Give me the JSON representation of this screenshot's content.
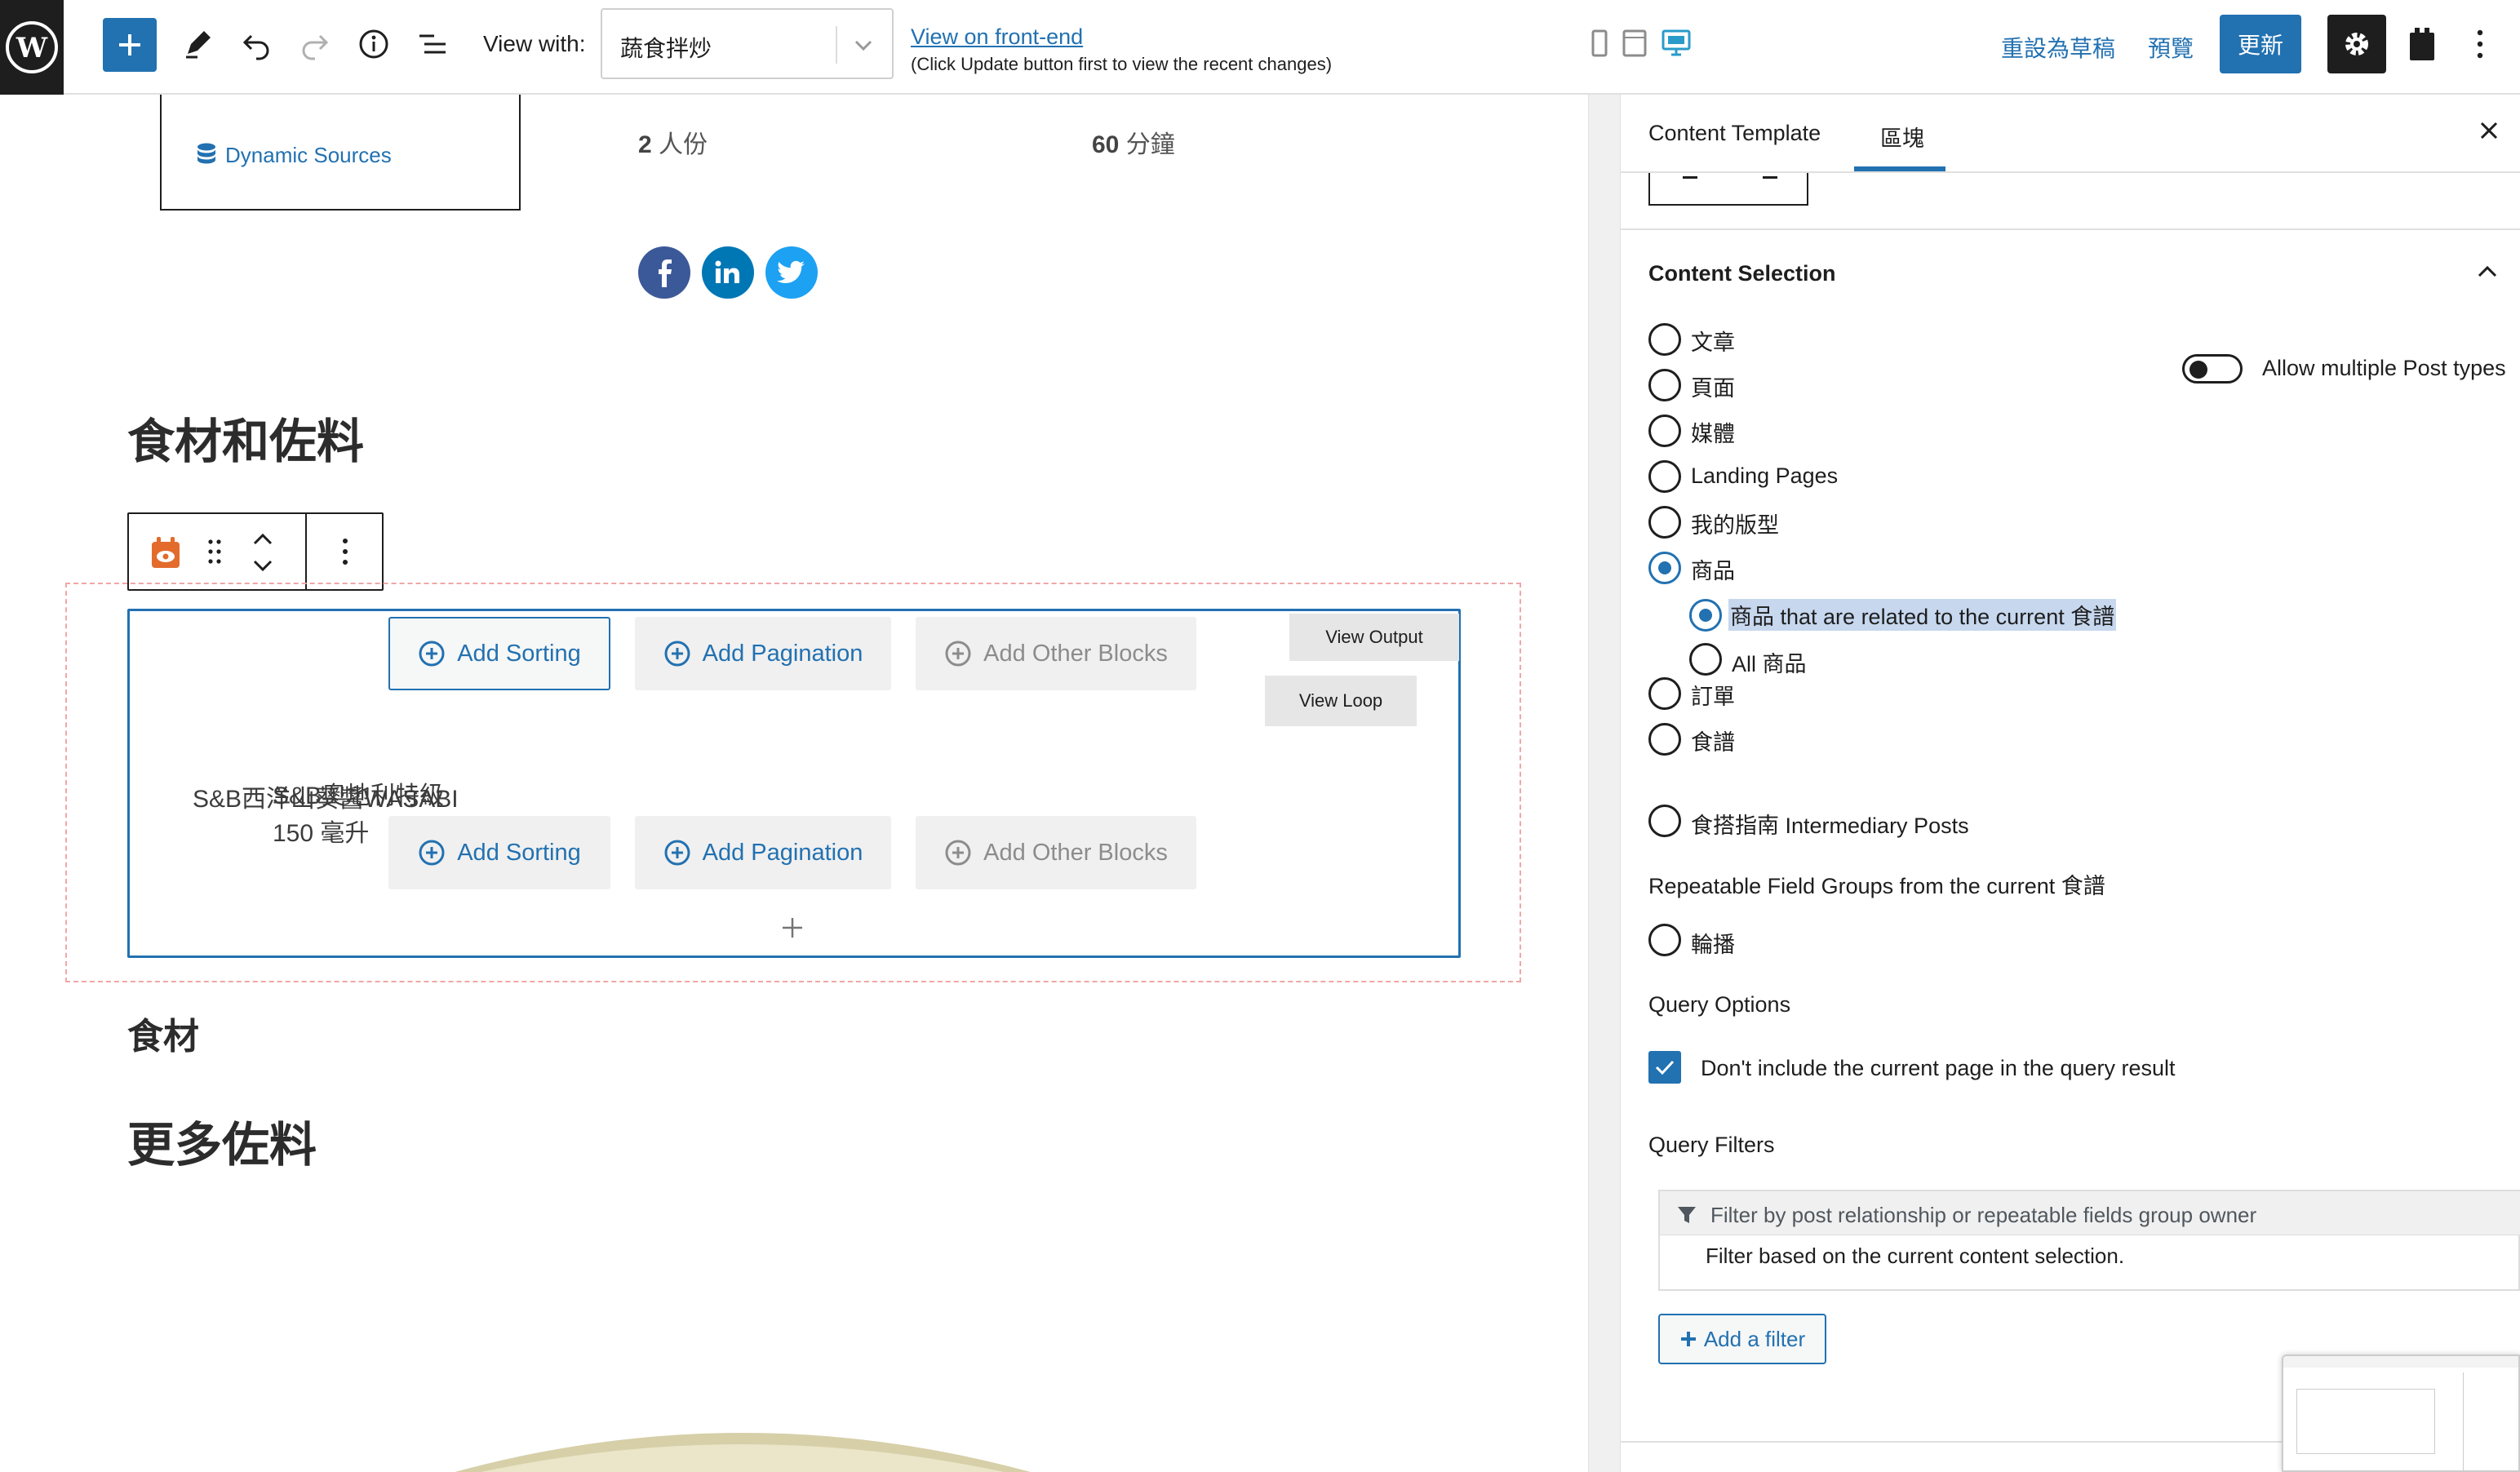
{
  "toolbar": {
    "view_with_label": "View with:",
    "view_with_value": "蔬食拌炒",
    "frontend_link": "View on front-end",
    "frontend_note": "(Click Update button first to view the recent changes)",
    "reset_draft": "重設為草稿",
    "preview": "預覽",
    "update": "更新"
  },
  "canvas": {
    "dynamic_sources": "Dynamic Sources",
    "servings_num": "2",
    "servings_unit": "人份",
    "time_num": "60",
    "time_unit": "分鐘",
    "heading_ingredients_seasoning": "食材和佐料",
    "heading_ingredients": "食材",
    "heading_more_seasoning": "更多佐料",
    "loop": {
      "add_sorting": "Add Sorting",
      "add_pagination": "Add Pagination",
      "add_other_blocks": "Add Other Blocks",
      "view_output": "View Output",
      "view_loop": "View Loop",
      "overlap_text_a": "S&B西洋山葵醬WASABI",
      "overlap_text_b": "S&B奧地利特級",
      "overlap_text_c": "150 毫升"
    }
  },
  "sidebar": {
    "tab_content_template": "Content Template",
    "tab_block": "區塊",
    "content_selection_title": "Content Selection",
    "post_types": [
      "文章",
      "頁面",
      "媒體",
      "Landing Pages",
      "我的版型",
      "商品"
    ],
    "related_option": "商品 that are related to the current 食譜",
    "all_option": "All 商品",
    "post_types_2": [
      "訂單",
      "食譜"
    ],
    "intermediary": "食搭指南 Intermediary Posts",
    "allow_multiple": "Allow multiple Post types",
    "rfg_title": "Repeatable Field Groups from the current 食譜",
    "rfg_item": "輪播",
    "query_options_title": "Query Options",
    "dont_include": "Don't include the current page in the query result",
    "query_filters_title": "Query Filters",
    "filter_head": "Filter by post relationship or repeatable fields group owner",
    "filter_desc": "Filter based on the current content selection.",
    "add_filter": "Add a filter"
  }
}
